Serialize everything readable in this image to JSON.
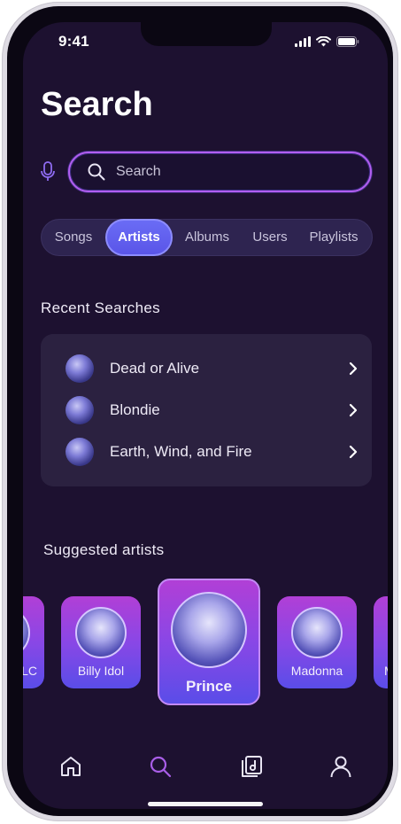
{
  "status": {
    "time": "9:41"
  },
  "page": {
    "title": "Search"
  },
  "search": {
    "placeholder": "Search"
  },
  "tabs": [
    {
      "label": "Songs",
      "active": false
    },
    {
      "label": "Artists",
      "active": true
    },
    {
      "label": "Albums",
      "active": false
    },
    {
      "label": "Users",
      "active": false
    },
    {
      "label": "Playlists",
      "active": false
    }
  ],
  "recent": {
    "title": "Recent Searches",
    "items": [
      {
        "label": "Dead or Alive"
      },
      {
        "label": "Blondie"
      },
      {
        "label": "Earth, Wind, and Fire"
      }
    ]
  },
  "suggested": {
    "title": "Suggested artists",
    "artists": [
      {
        "name": "LC",
        "partial": true
      },
      {
        "name": "Billy Idol"
      },
      {
        "name": "Prince",
        "featured": true
      },
      {
        "name": "Madonna"
      },
      {
        "name": "M",
        "partial": true
      }
    ]
  },
  "nav": [
    {
      "icon": "home-icon",
      "active": false
    },
    {
      "icon": "search-icon",
      "active": true
    },
    {
      "icon": "library-icon",
      "active": false
    },
    {
      "icon": "profile-icon",
      "active": false
    }
  ],
  "colors": {
    "background": "#1d1130",
    "accent": "#b25ef0",
    "tab_active": "#5a55e8",
    "card": "#2b2140"
  }
}
